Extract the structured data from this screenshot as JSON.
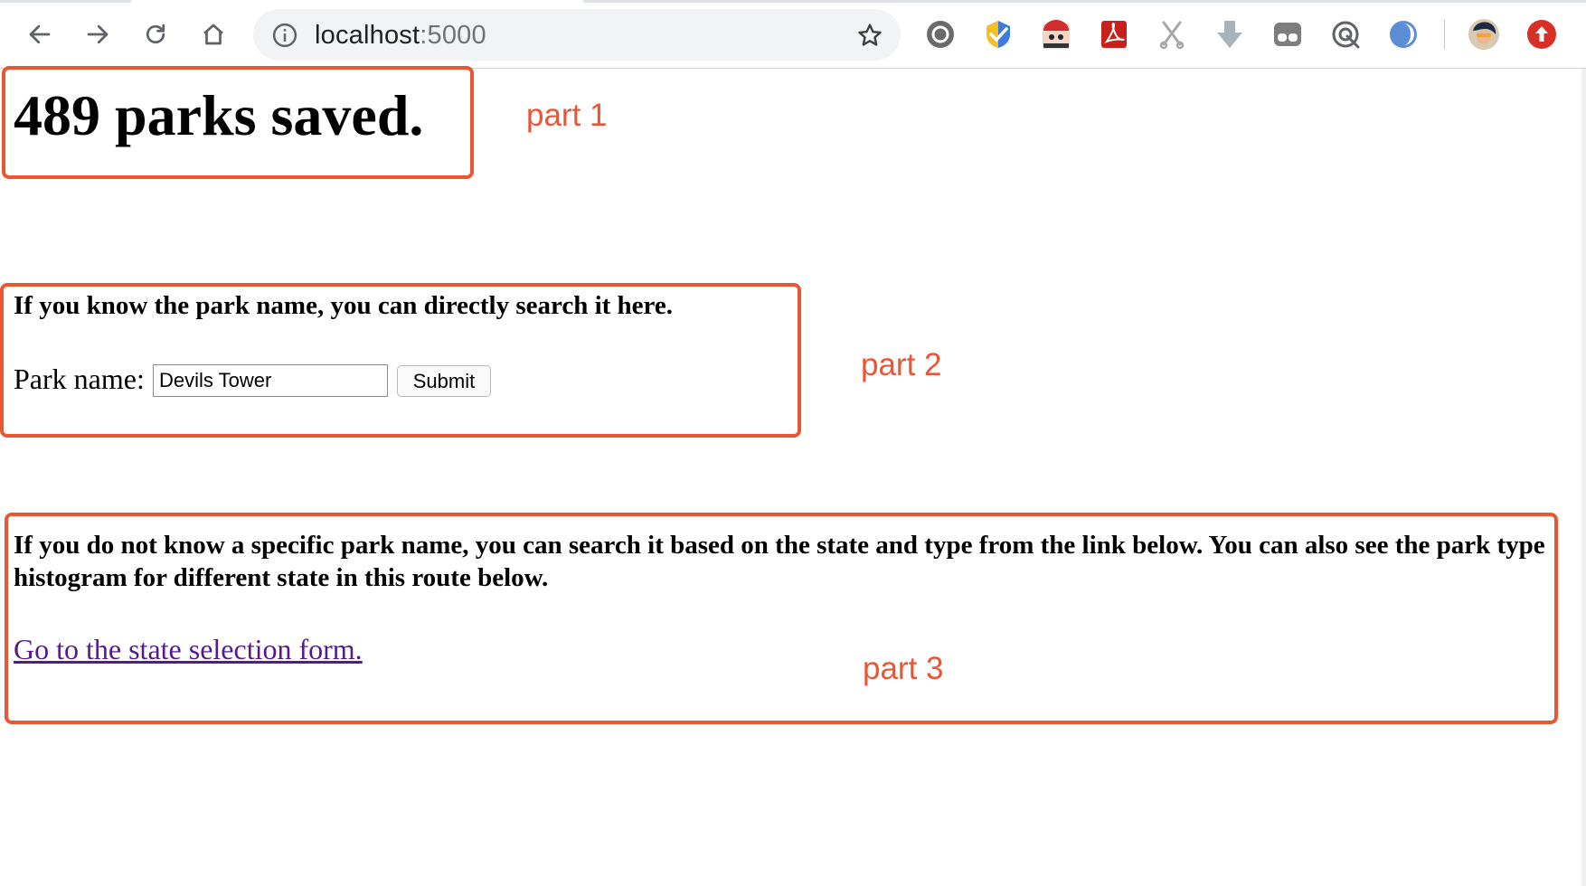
{
  "browser": {
    "url_host": "localhost",
    "url_port": ":5000",
    "accent_color": "#ea5533"
  },
  "toolbar_icons": [
    "back-icon",
    "forward-icon",
    "reload-icon",
    "home-icon",
    "info-icon",
    "bookmark-star-icon"
  ],
  "extensions": [
    "circle-extension-icon",
    "checkmark-extension-icon",
    "manga-extension-icon",
    "pdf-extension-icon",
    "scissors-extension-icon",
    "download-arrow-extension-icon",
    "glasses-extension-icon",
    "target-extension-icon",
    "half-moon-extension-icon",
    "profile-avatar-icon",
    "update-arrow-icon"
  ],
  "page": {
    "heading": "489 parks saved.",
    "search_heading": "If you know the park name, you can directly search it here.",
    "park_name_label": "Park name:",
    "park_name_value": "Devils Tower",
    "submit_label": "Submit",
    "state_heading": "If you do not know a specific park name, you can search it based on the state and type from the link below. You can also see the park type histogram for different state in this route below.",
    "state_link": "Go to the state selection form. "
  },
  "annotations": {
    "part1": "part 1",
    "part2": "part 2",
    "part3": "part 3"
  }
}
